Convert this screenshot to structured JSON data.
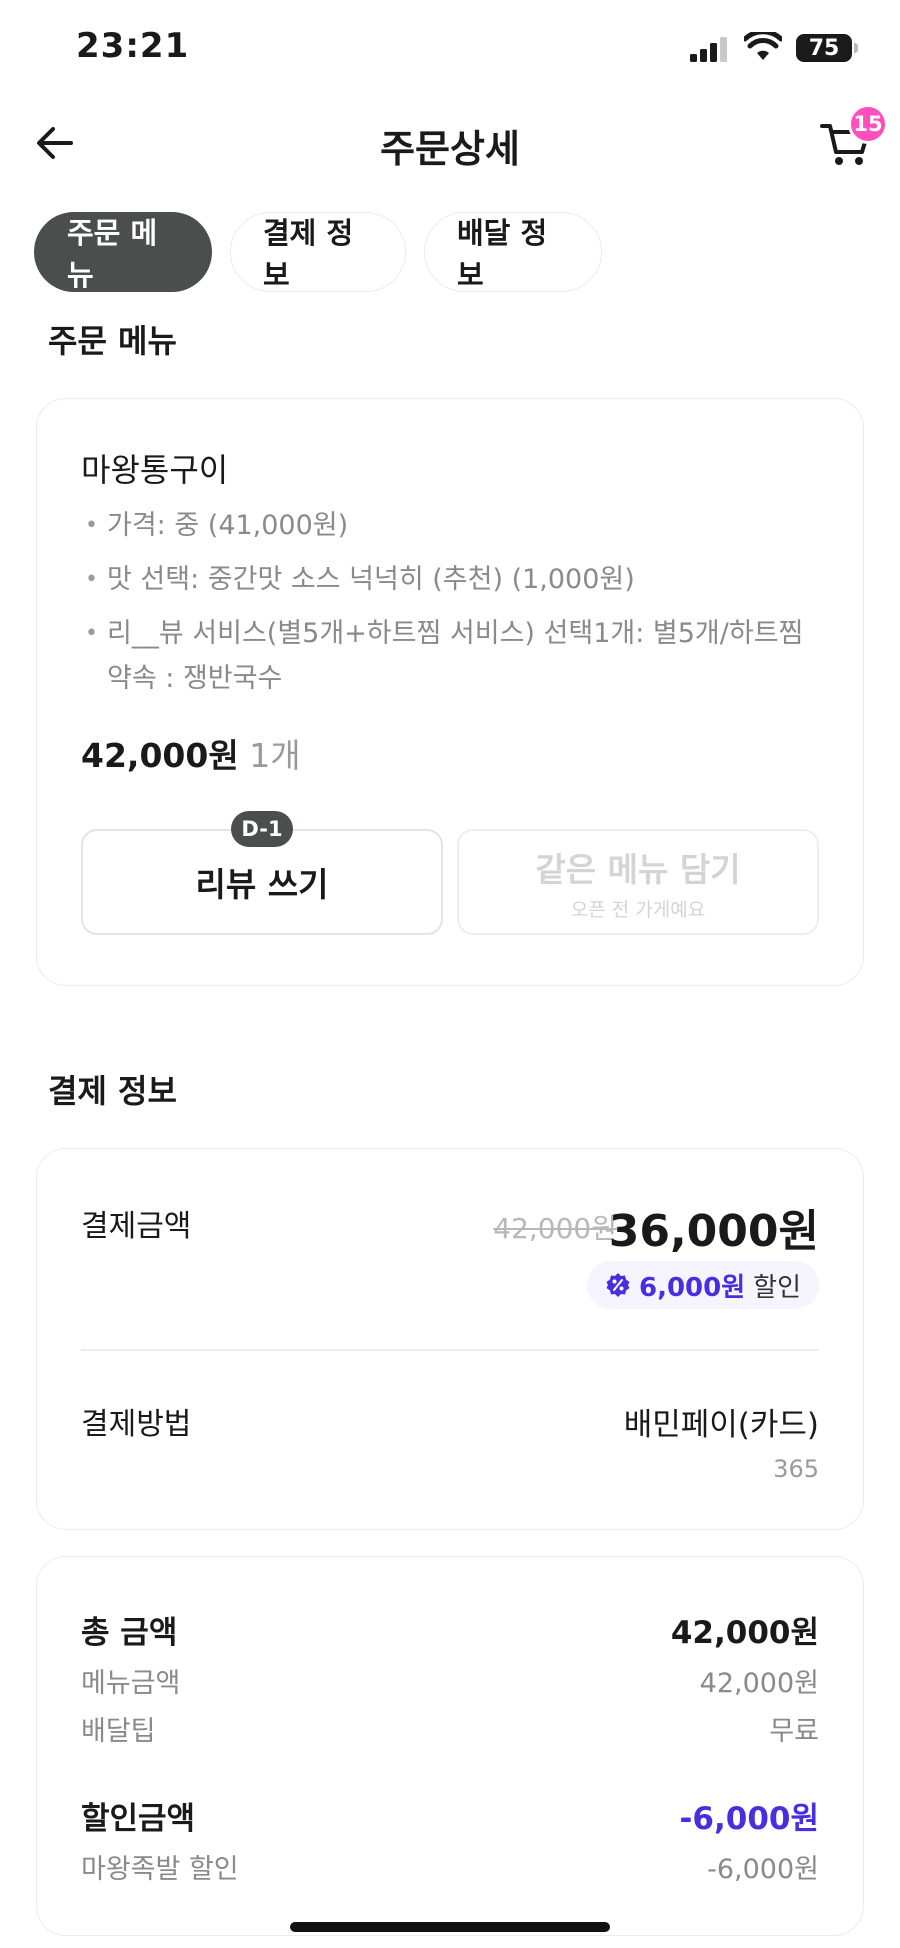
{
  "status_bar": {
    "time": "23:21",
    "battery": "75"
  },
  "header": {
    "title": "주문상세",
    "cart_count": "15"
  },
  "tabs": [
    {
      "label": "주문 메뉴",
      "active": true
    },
    {
      "label": "결제 정보",
      "active": false
    },
    {
      "label": "배달 정보",
      "active": false
    }
  ],
  "order_section": {
    "title": "주문 메뉴",
    "menu_name": "마왕통구이",
    "options": [
      "가격: 중 (41,000원)",
      "맛 선택: 중간맛 소스 넉넉히 (추천) (1,000원)",
      "리__뷰 서비스(별5개+하트찜 서비스) 선택1개: 별5개/하트찜 약속 : 쟁반국수"
    ],
    "price": "42,000원",
    "quantity": "1개",
    "review_button": "리뷰 쓰기",
    "review_badge": "D-1",
    "same_menu_button": "같은 메뉴 담기",
    "same_menu_sub": "오픈 전 가게예요"
  },
  "payment_section": {
    "title": "결제 정보",
    "amount_label": "결제금액",
    "original_amount": "42,000원",
    "final_amount": "36,000원",
    "discount_amount": "6,000원",
    "discount_label": "할인",
    "method_label": "결제방법",
    "method_value": "배민페이(카드)",
    "method_sub": "365"
  },
  "totals": {
    "total_label": "총 금액",
    "total_value": "42,000원",
    "menu_label": "메뉴금액",
    "menu_value": "42,000원",
    "delivery_label": "배달팁",
    "delivery_value": "무료",
    "discount_label": "할인금액",
    "discount_value": "-6,000원",
    "store_discount_label": "마왕족발 할인",
    "store_discount_value": "-6,000원"
  },
  "colors": {
    "accent_purple": "#4a2de0",
    "badge_pink": "#ff4fbd",
    "active_tab": "#4a4e4d"
  }
}
